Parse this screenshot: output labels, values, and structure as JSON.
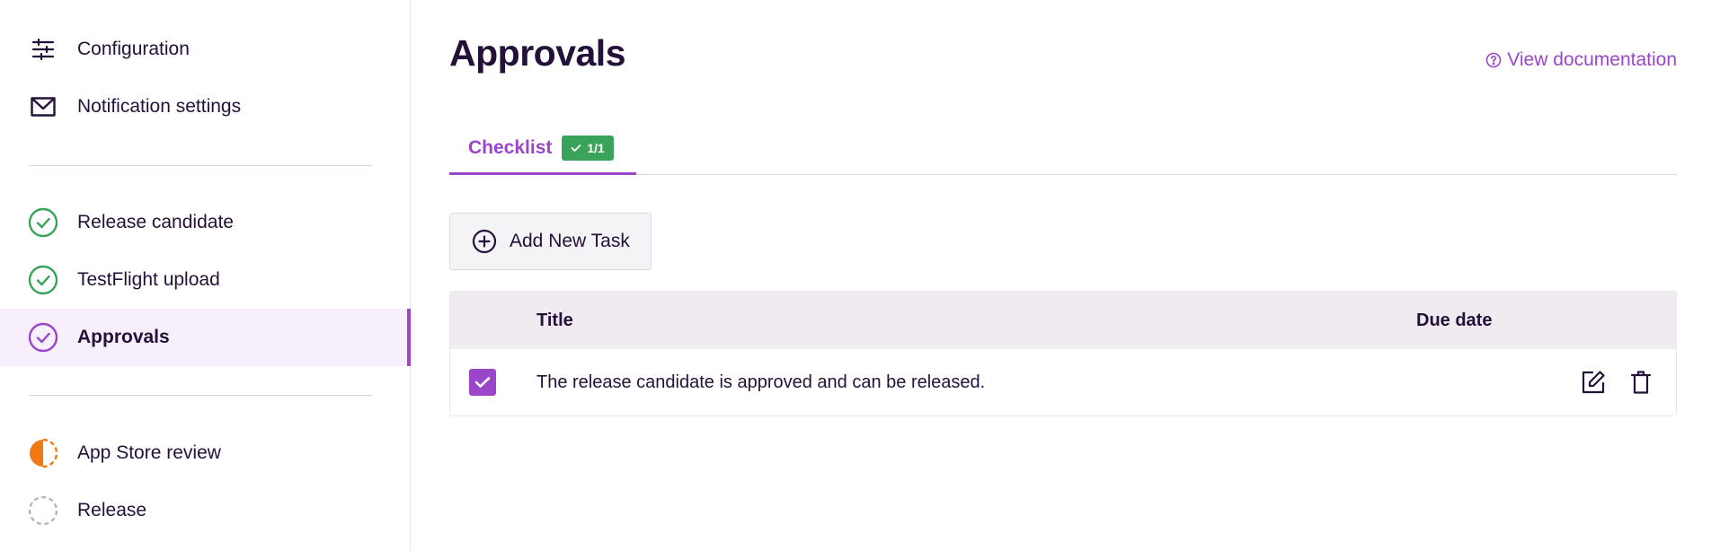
{
  "sidebar": {
    "items": [
      {
        "label": "Configuration",
        "icon": "sliders-icon"
      },
      {
        "label": "Notification settings",
        "icon": "envelope-icon"
      },
      {
        "label": "Release candidate",
        "icon": "check-circle-icon",
        "status": "done"
      },
      {
        "label": "TestFlight upload",
        "icon": "check-circle-icon",
        "status": "done"
      },
      {
        "label": "Approvals",
        "icon": "check-circle-icon",
        "status": "active"
      },
      {
        "label": "App Store review",
        "icon": "half-circle-icon",
        "status": "in-progress"
      },
      {
        "label": "Release",
        "icon": "dashed-circle-icon",
        "status": "pending"
      }
    ]
  },
  "header": {
    "title": "Approvals",
    "doc_link": "View documentation"
  },
  "tabs": [
    {
      "label": "Checklist",
      "badge": "1/1",
      "active": true
    }
  ],
  "toolbar": {
    "add_label": "Add New Task"
  },
  "table": {
    "columns": [
      "Title",
      "Due date"
    ],
    "rows": [
      {
        "checked": true,
        "title": "The release candidate is approved and can be released.",
        "due_date": ""
      }
    ]
  },
  "colors": {
    "accent": "#9b45c9",
    "success": "#3aa35a",
    "warning": "#f07a12",
    "text": "#241139",
    "muted": "#b8b4bc"
  }
}
